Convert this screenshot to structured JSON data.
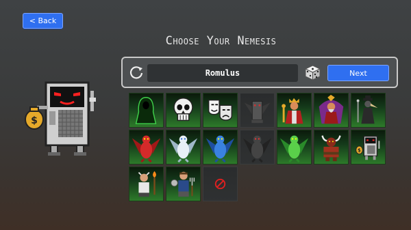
{
  "header": {
    "back_label": "< Back",
    "title": "Choose Your Nemesis"
  },
  "selector": {
    "name_value": "Romulus",
    "next_label": "Next"
  },
  "colors": {
    "accent": "#2f6ff0",
    "tile_green": "#2d7a2a",
    "panel": "#4d5052"
  },
  "nemeses": [
    {
      "icon": "hooded-ghost-icon"
    },
    {
      "icon": "skull-icon"
    },
    {
      "icon": "theater-masks-icon"
    },
    {
      "icon": "gray-gargoyle-icon"
    },
    {
      "icon": "red-king-icon"
    },
    {
      "icon": "purple-sorcerer-icon"
    },
    {
      "icon": "plague-doctor-icon"
    },
    {
      "icon": "red-dragon-icon"
    },
    {
      "icon": "white-dragon-icon"
    },
    {
      "icon": "blue-dragon-icon"
    },
    {
      "icon": "black-dragon-icon"
    },
    {
      "icon": "green-dragon-icon"
    },
    {
      "icon": "minotaur-icon"
    },
    {
      "icon": "robot-banker-icon"
    },
    {
      "icon": "torch-villager-icon"
    },
    {
      "icon": "pitchfork-villager-icon"
    },
    {
      "icon": "none-icon"
    }
  ]
}
